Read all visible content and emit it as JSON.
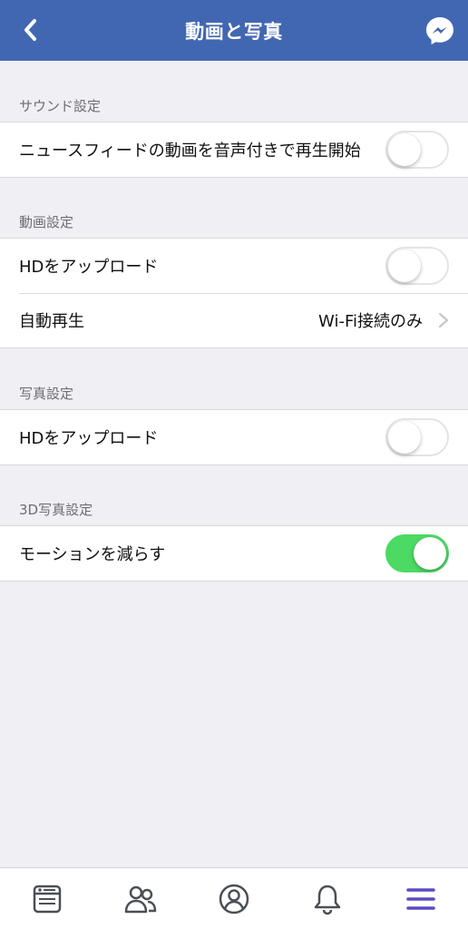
{
  "header": {
    "title": "動画と写真",
    "back_icon": "chevron-left-icon",
    "messenger_icon": "messenger-icon",
    "background": "#4267b2"
  },
  "sections": {
    "sound": {
      "label": "サウンド設定",
      "rows": [
        {
          "label": "ニュースフィードの動画を音声付きで再生開始",
          "toggle": false
        }
      ]
    },
    "video": {
      "label": "動画設定",
      "rows": [
        {
          "label": "HDをアップロード",
          "toggle": false
        },
        {
          "label": "自動再生",
          "value": "Wi-Fi接続のみ"
        }
      ]
    },
    "photo": {
      "label": "写真設定",
      "rows": [
        {
          "label": "HDをアップロード",
          "toggle": false
        }
      ]
    },
    "photo3d": {
      "label": "3D写真設定",
      "rows": [
        {
          "label": "モーションを減らす",
          "toggle": true
        }
      ]
    }
  },
  "tabbar": {
    "items": [
      {
        "icon": "news-feed-icon",
        "active": false
      },
      {
        "icon": "friends-icon",
        "active": false
      },
      {
        "icon": "profile-icon",
        "active": false
      },
      {
        "icon": "bell-icon",
        "active": false
      },
      {
        "icon": "menu-icon",
        "active": true
      }
    ],
    "active_color": "#5b4bc4",
    "inactive_color": "#4b4f56"
  },
  "colors": {
    "toggle_on": "#4cd964",
    "page_background": "#efeff4"
  }
}
